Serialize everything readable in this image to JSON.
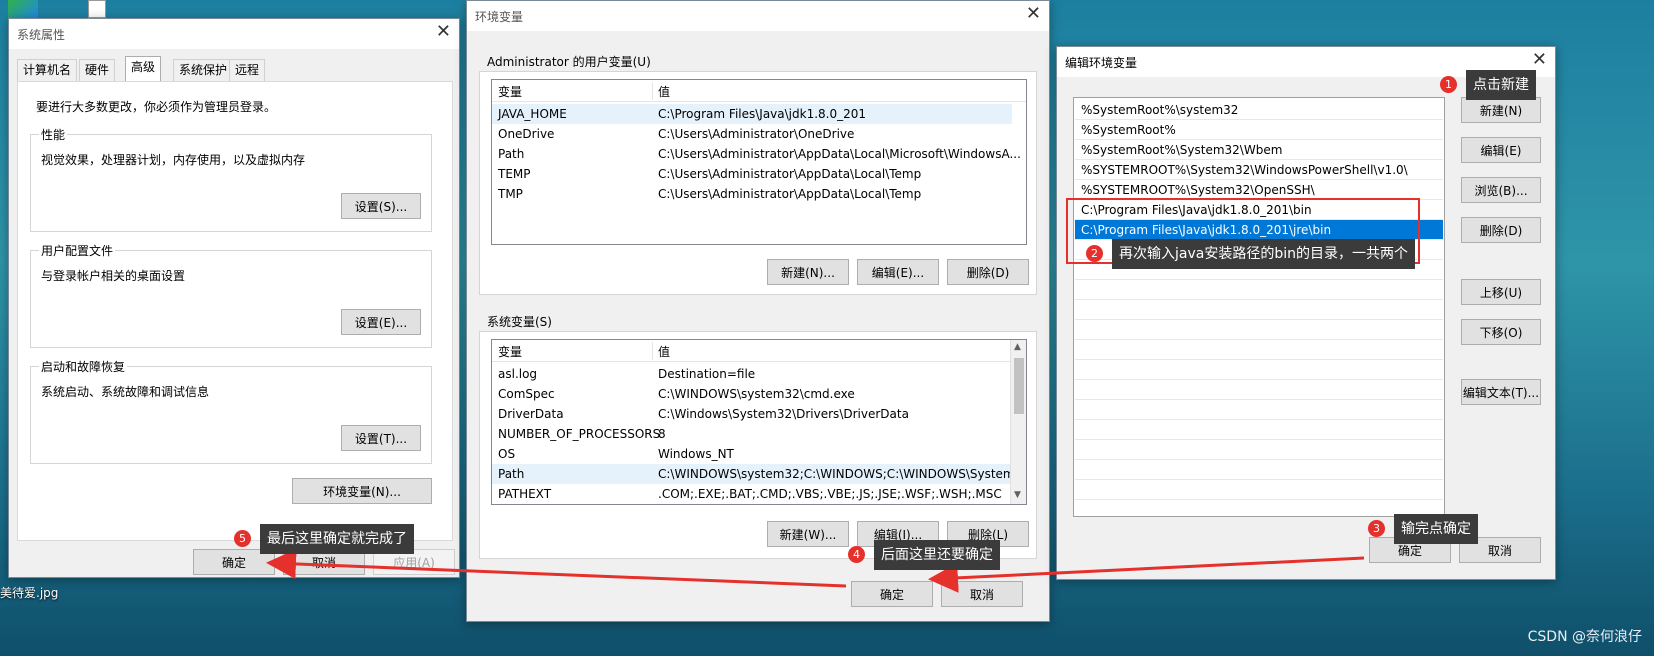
{
  "desktop": {
    "file_label": "美待爱.jpg",
    "watermark": "CSDN @奈何浪仔"
  },
  "sysprops": {
    "title": "系统属性",
    "tabs": [
      "计算机名",
      "硬件",
      "高级",
      "系统保护",
      "远程"
    ],
    "admin_note": "要进行大多数更改，你必须作为管理员登录。",
    "perf_legend": "性能",
    "perf_desc": "视觉效果，处理器计划，内存使用，以及虚拟内存",
    "perf_btn": "设置(S)...",
    "profile_legend": "用户配置文件",
    "profile_desc": "与登录帐户相关的桌面设置",
    "profile_btn": "设置(E)...",
    "startup_legend": "启动和故障恢复",
    "startup_desc": "系统启动、系统故障和调试信息",
    "startup_btn": "设置(T)...",
    "env_btn": "环境变量(N)...",
    "ok": "确定",
    "cancel": "取消",
    "apply": "应用(A)"
  },
  "envvars": {
    "title": "环境变量",
    "user_legend": "Administrator 的用户变量(U)",
    "col_var": "变量",
    "col_val": "值",
    "user_rows": [
      {
        "name": "JAVA_HOME",
        "value": "C:\\Program Files\\Java\\jdk1.8.0_201"
      },
      {
        "name": "OneDrive",
        "value": "C:\\Users\\Administrator\\OneDrive"
      },
      {
        "name": "Path",
        "value": "C:\\Users\\Administrator\\AppData\\Local\\Microsoft\\WindowsA..."
      },
      {
        "name": "TEMP",
        "value": "C:\\Users\\Administrator\\AppData\\Local\\Temp"
      },
      {
        "name": "TMP",
        "value": "C:\\Users\\Administrator\\AppData\\Local\\Temp"
      }
    ],
    "user_new": "新建(N)...",
    "user_edit": "编辑(E)...",
    "user_delete": "删除(D)",
    "sys_legend": "系统变量(S)",
    "sys_rows": [
      {
        "name": "asl.log",
        "value": "Destination=file"
      },
      {
        "name": "ComSpec",
        "value": "C:\\WINDOWS\\system32\\cmd.exe"
      },
      {
        "name": "DriverData",
        "value": "C:\\Windows\\System32\\Drivers\\DriverData"
      },
      {
        "name": "NUMBER_OF_PROCESSORS",
        "value": "8"
      },
      {
        "name": "OS",
        "value": "Windows_NT"
      },
      {
        "name": "Path",
        "value": "C:\\WINDOWS\\system32;C:\\WINDOWS;C:\\WINDOWS\\System..."
      },
      {
        "name": "PATHEXT",
        "value": ".COM;.EXE;.BAT;.CMD;.VBS;.VBE;.JS;.JSE;.WSF;.WSH;.MSC"
      }
    ],
    "sys_new": "新建(W)...",
    "sys_edit": "编辑(I)...",
    "sys_delete": "删除(L)",
    "ok": "确定",
    "cancel": "取消"
  },
  "editenv": {
    "title": "编辑环境变量",
    "entries": [
      "%SystemRoot%\\system32",
      "%SystemRoot%",
      "%SystemRoot%\\System32\\Wbem",
      "%SYSTEMROOT%\\System32\\WindowsPowerShell\\v1.0\\",
      "%SYSTEMROOT%\\System32\\OpenSSH\\",
      "C:\\Program Files\\Java\\jdk1.8.0_201\\bin",
      "C:\\Program Files\\Java\\jdk1.8.0_201\\jre\\bin"
    ],
    "new": "新建(N)",
    "edit": "编辑(E)",
    "browse": "浏览(B)...",
    "delete": "删除(D)",
    "up": "上移(U)",
    "down": "下移(O)",
    "edit_text": "编辑文本(T)...",
    "ok": "确定",
    "cancel": "取消"
  },
  "annotations": {
    "c1": {
      "num": "1",
      "text": "点击新建"
    },
    "c2": {
      "num": "2",
      "text": "再次输入java安装路径的bin的目录，一共两个"
    },
    "c3": {
      "num": "3",
      "text": "输完点确定"
    },
    "c4": {
      "num": "4",
      "text": "后面这里还要确定"
    },
    "c5": {
      "num": "5",
      "text": "最后这里确定就完成了"
    },
    "accent": "#e5302c"
  }
}
